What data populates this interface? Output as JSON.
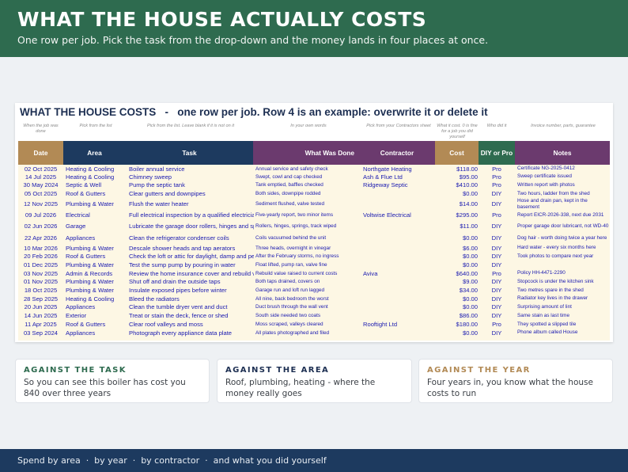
{
  "hero": {
    "title": "WHAT THE HOUSE ACTUALLY COSTS",
    "subtitle": "One row per job. Pick the task from the drop-down and the money lands in four places at once."
  },
  "sheet": {
    "title": "WHAT THE HOUSE COSTS   -   one row per job. Row 4 is an example: overwrite it or delete it",
    "hints": [
      "When the job was done",
      "Pick from the list",
      "Pick from the list. Leave blank if it is not on it",
      "In your own words",
      "Pick from your Contractors sheet",
      "What it cost. 0 is fine for a job you did yourself",
      "Who did it",
      "Invoice number, parts, guarantee"
    ],
    "headers": [
      "Date",
      "Area",
      "Task",
      "What Was Done",
      "Contractor",
      "Cost",
      "DIY or Pro",
      "Notes"
    ],
    "header_colors": [
      "#b28a55",
      "#1d3a5f",
      "#1d3a5f",
      "#6b3a6e",
      "#6b3a6e",
      "#b28a55",
      "#2e6b4f",
      "#6b3a6e"
    ],
    "rows": [
      [
        "02 Oct 2025",
        "Heating & Cooling",
        "Boiler annual service",
        "Annual service and safety check",
        "Northgate Heating",
        "$118.00",
        "Pro",
        "Certificate NG-2025-0412"
      ],
      [
        "14 Jul 2025",
        "Heating & Cooling",
        "Chimney sweep",
        "Swept, cowl and cap checked",
        "Ash & Flue Ltd",
        "$95.00",
        "Pro",
        "Sweep certificate issued"
      ],
      [
        "30 May 2024",
        "Septic & Well",
        "Pump the septic tank",
        "Tank emptied, baffles checked",
        "Ridgeway Septic",
        "$410.00",
        "Pro",
        "Written report with photos"
      ],
      [
        "05 Oct 2025",
        "Roof & Gutters",
        "Clear gutters and downpipes",
        "Both sides, downpipe rodded",
        "",
        "$0.00",
        "DIY",
        "Two hours, ladder from the shed"
      ],
      [
        "12 Nov 2025",
        "Plumbing & Water",
        "Flush the water heater",
        "Sediment flushed, valve tested",
        "",
        "$14.00",
        "DIY",
        "Hose and drain pan, kept in the basement"
      ],
      [
        "09 Jul 2026",
        "Electrical",
        "Full electrical inspection by a qualified electrician",
        "Five-yearly report, two minor items",
        "Voltwise Electrical",
        "$295.00",
        "Pro",
        "Report EICR-2026-338, next due 2031"
      ],
      [
        "02 Jun 2026",
        "Garage",
        "Lubricate the garage door rollers, hinges and springs",
        "Rollers, hinges, springs, track wiped",
        "",
        "$11.00",
        "DIY",
        "Proper garage door lubricant, not WD-40"
      ],
      [
        "22 Apr 2026",
        "Appliances",
        "Clean the refrigerator condenser coils",
        "Coils vacuumed behind the unit",
        "",
        "$0.00",
        "DIY",
        "Dog hair - worth doing twice a year here"
      ],
      [
        "10 Mar 2026",
        "Plumbing & Water",
        "Descale shower heads and tap aerators",
        "Three heads, overnight in vinegar",
        "",
        "$6.00",
        "DIY",
        "Hard water - every six months here"
      ],
      [
        "20 Feb 2026",
        "Roof & Gutters",
        "Check the loft or attic for daylight, damp and pests",
        "After the February storms, no ingress",
        "",
        "$0.00",
        "DIY",
        "Took photos to compare next year"
      ],
      [
        "01 Dec 2025",
        "Plumbing & Water",
        "Test the sump pump by pouring in water",
        "Float lifted, pump ran, valve fine",
        "",
        "$0.00",
        "DIY",
        ""
      ],
      [
        "03 Nov 2025",
        "Admin & Records",
        "Review the home insurance cover and rebuild value",
        "Rebuild value raised to current costs",
        "Aviva",
        "$640.00",
        "Pro",
        "Policy HH-4471-2290"
      ],
      [
        "01 Nov 2025",
        "Plumbing & Water",
        "Shut off and drain the outside taps",
        "Both taps drained, covers on",
        "",
        "$9.00",
        "DIY",
        "Stopcock is under the kitchen sink"
      ],
      [
        "18 Oct 2025",
        "Plumbing & Water",
        "Insulate exposed pipes before winter",
        "Garage run and loft run lagged",
        "",
        "$34.00",
        "DIY",
        "Two metres spare in the shed"
      ],
      [
        "28 Sep 2025",
        "Heating & Cooling",
        "Bleed the radiators",
        "All nine, back bedroom the worst",
        "",
        "$0.00",
        "DIY",
        "Radiator key lives in the drawer"
      ],
      [
        "20 Jun 2025",
        "Appliances",
        "Clean the tumble dryer vent and duct",
        "Duct brush through the wall vent",
        "",
        "$0.00",
        "DIY",
        "Surprising amount of lint"
      ],
      [
        "14 Jun 2025",
        "Exterior",
        "Treat or stain the deck, fence or shed",
        "South side needed two coats",
        "",
        "$86.00",
        "DIY",
        "Same stain as last time"
      ],
      [
        "11 Apr 2025",
        "Roof & Gutters",
        "Clear roof valleys and moss",
        "Moss scraped, valleys cleared",
        "Rooftight Ltd",
        "$180.00",
        "Pro",
        "They spotted a slipped tile"
      ],
      [
        "03 Sep 2024",
        "Appliances",
        "Photograph every appliance data plate",
        "All plates photographed and filed",
        "",
        "$0.00",
        "DIY",
        "Phone album called House"
      ]
    ]
  },
  "cards": [
    {
      "heading": "AGAINST THE TASK",
      "body": "So you can see this boiler has cost you 840 over three years",
      "color": "#2e6b4f"
    },
    {
      "heading": "AGAINST THE AREA",
      "body": "Roof, plumbing, heating - where the money really goes",
      "color": "#1d2f52"
    },
    {
      "heading": "AGAINST THE YEAR",
      "body": "Four years in, you know what the house costs to run",
      "color": "#b28a55"
    }
  ],
  "footer": "Spend by area  ·  by year  ·  by contractor  ·  and what you did yourself"
}
